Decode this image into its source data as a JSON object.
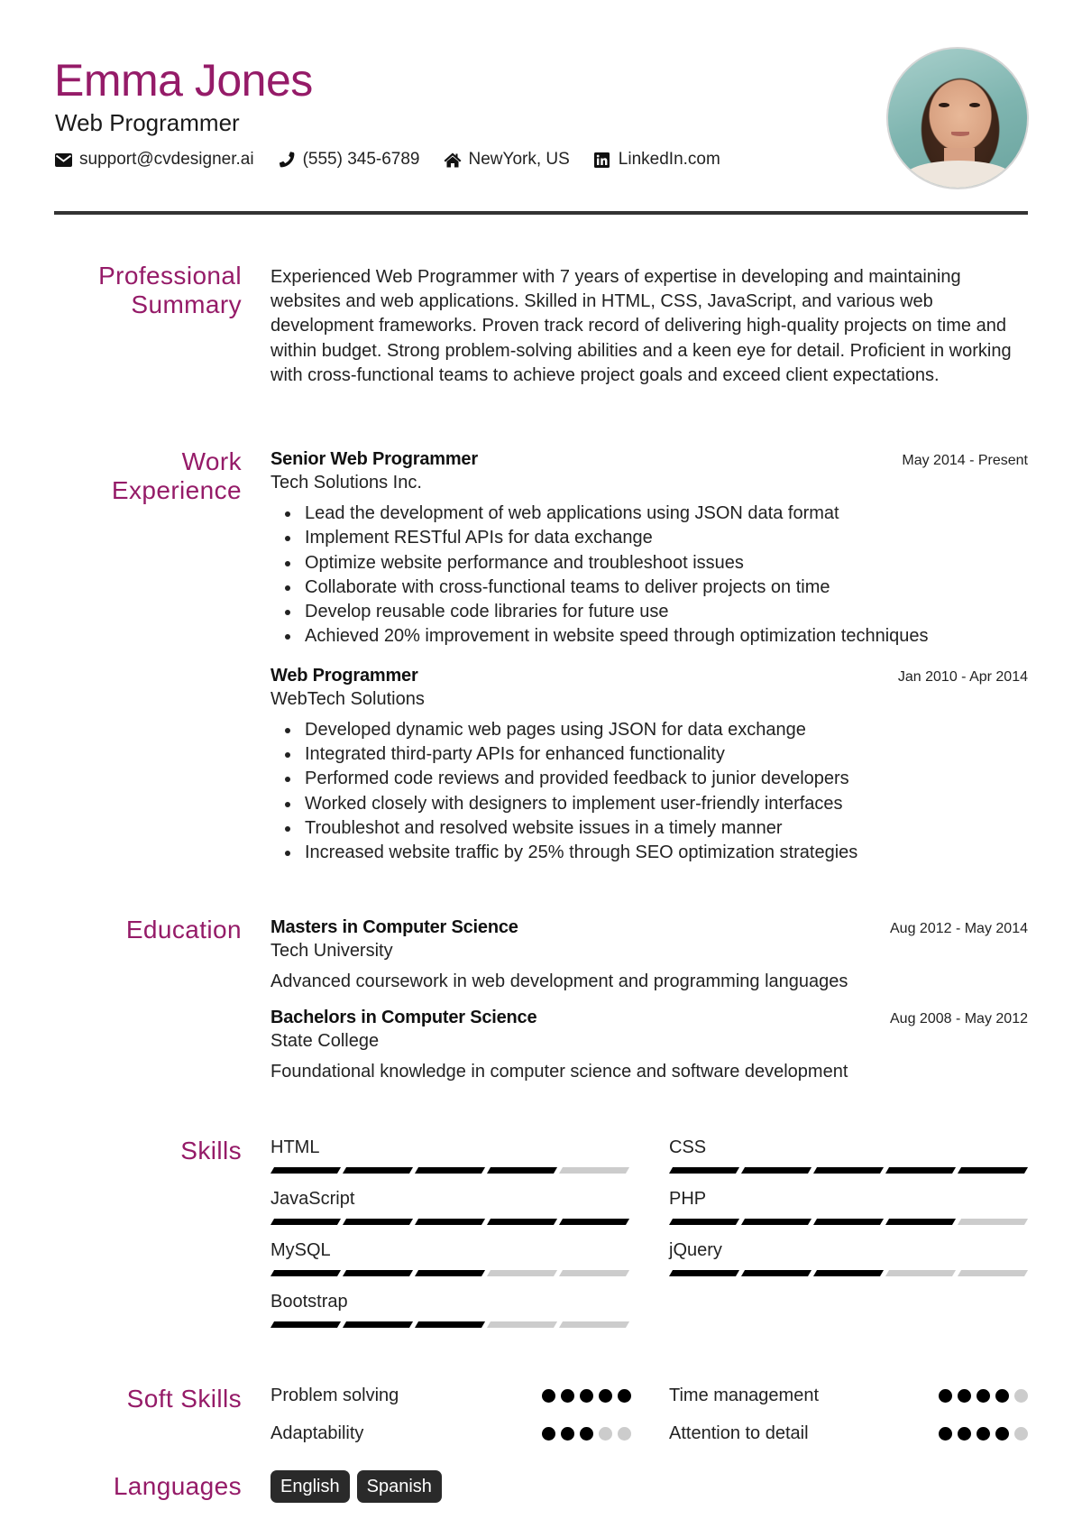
{
  "header": {
    "name": "Emma Jones",
    "title": "Web Programmer",
    "contacts": [
      {
        "icon": "envelope-icon",
        "text": "support@cvdesigner.ai"
      },
      {
        "icon": "phone-icon",
        "text": "(555) 345-6789"
      },
      {
        "icon": "home-icon",
        "text": "NewYork, US"
      },
      {
        "icon": "linkedin-icon",
        "text": "LinkedIn.com"
      }
    ],
    "photo_alt": "Profile photo of Emma Jones"
  },
  "colors": {
    "accent": "#951b68",
    "rule": "#333333",
    "bar_on": "#000000",
    "bar_off": "#cccccc",
    "badge_bg": "#2a2a2a"
  },
  "summary": {
    "label": "Professional Summary",
    "text": "Experienced Web Programmer with 7 years of expertise in developing and maintaining websites and web applications. Skilled in HTML, CSS, JavaScript, and various web development frameworks. Proven track record of delivering high-quality projects on time and within budget. Strong problem-solving abilities and a keen eye for detail. Proficient in working with cross-functional teams to achieve project goals and exceed client expectations."
  },
  "experience": {
    "label": "Work Experience",
    "jobs": [
      {
        "title": "Senior Web Programmer",
        "company": "Tech Solutions Inc.",
        "dates": "May 2014 - Present",
        "bullets": [
          "Lead the development of web applications using JSON data format",
          "Implement RESTful APIs for data exchange",
          "Optimize website performance and troubleshoot issues",
          "Collaborate with cross-functional teams to deliver projects on time",
          "Develop reusable code libraries for future use",
          "Achieved 20% improvement in website speed through optimization techniques"
        ]
      },
      {
        "title": "Web Programmer",
        "company": "WebTech Solutions",
        "dates": "Jan 2010 - Apr 2014",
        "bullets": [
          "Developed dynamic web pages using JSON for data exchange",
          "Integrated third-party APIs for enhanced functionality",
          "Performed code reviews and provided feedback to junior developers",
          "Worked closely with designers to implement user-friendly interfaces",
          "Troubleshot and resolved website issues in a timely manner",
          "Increased website traffic by 25% through SEO optimization strategies"
        ]
      }
    ]
  },
  "education": {
    "label": "Education",
    "items": [
      {
        "degree": "Masters in Computer Science",
        "school": "Tech University",
        "dates": "Aug 2012 - May 2014",
        "description": "Advanced coursework in web development and programming languages"
      },
      {
        "degree": "Bachelors in Computer Science",
        "school": "State College",
        "dates": "Aug 2008 - May 2012",
        "description": "Foundational knowledge in computer science and software development"
      }
    ]
  },
  "skills": {
    "label": "Skills",
    "max_level": 5,
    "items": [
      {
        "name": "HTML",
        "level": 4
      },
      {
        "name": "CSS",
        "level": 5
      },
      {
        "name": "JavaScript",
        "level": 5
      },
      {
        "name": "PHP",
        "level": 4
      },
      {
        "name": "MySQL",
        "level": 3
      },
      {
        "name": "jQuery",
        "level": 3
      },
      {
        "name": "Bootstrap",
        "level": 3
      }
    ]
  },
  "soft_skills": {
    "label": "Soft Skills",
    "max_level": 5,
    "items": [
      {
        "name": "Problem solving",
        "level": 5
      },
      {
        "name": "Time management",
        "level": 4
      },
      {
        "name": "Adaptability",
        "level": 3
      },
      {
        "name": "Attention to detail",
        "level": 4
      }
    ]
  },
  "languages": {
    "label": "Languages",
    "items": [
      "English",
      "Spanish"
    ]
  }
}
